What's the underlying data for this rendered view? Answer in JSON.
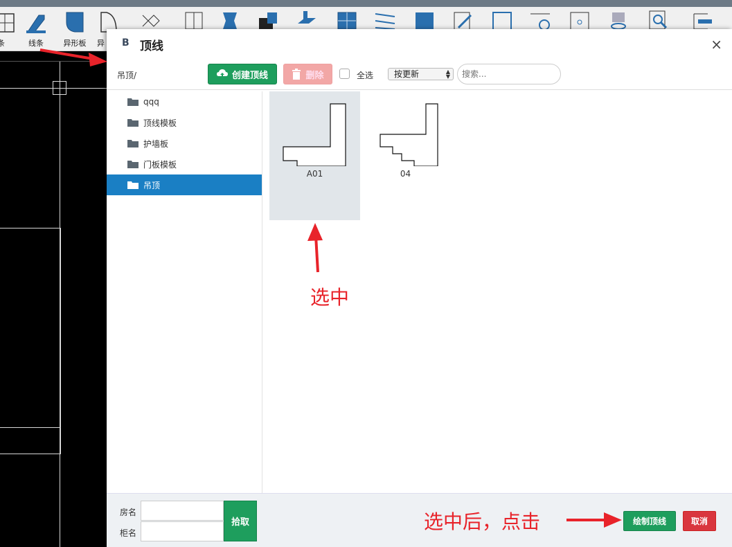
{
  "app_toolbar": {
    "items": [
      {
        "label": "条",
        "icon": "profile-strip-icon"
      },
      {
        "label": "线条",
        "icon": "line-strip-icon"
      },
      {
        "label": "异形板",
        "icon": "shaped-board-icon"
      },
      {
        "label": "异",
        "icon": "shaped-curve-icon"
      }
    ]
  },
  "dialog": {
    "title": "顶线",
    "logo": "B",
    "close": "×",
    "path": "吊顶/",
    "toolbar": {
      "create_label": "创建顶线",
      "delete_label": "删除",
      "select_all_label": "全选",
      "sort_value": "按更新",
      "search_placeholder": "搜索..."
    },
    "folders": [
      {
        "label": "qqq",
        "active": false
      },
      {
        "label": "顶线模板",
        "active": false
      },
      {
        "label": "护墙板",
        "active": false
      },
      {
        "label": "门板模板",
        "active": false
      },
      {
        "label": "吊顶",
        "active": true
      }
    ],
    "thumbnails": [
      {
        "label": "A01",
        "selected": true
      },
      {
        "label": "04",
        "selected": false
      }
    ],
    "footer": {
      "room_label": "房名",
      "cabinet_label": "柜名",
      "pick_label": "拾取",
      "draw_label": "绘制顶线",
      "cancel_label": "取消"
    }
  },
  "annotations": {
    "selected_note": "选中",
    "click_note": "选中后，点击",
    "color": "#e8232a"
  },
  "colors": {
    "green": "#1e9e5d",
    "blue_active": "#1a7fc4",
    "red": "#d9363e"
  }
}
